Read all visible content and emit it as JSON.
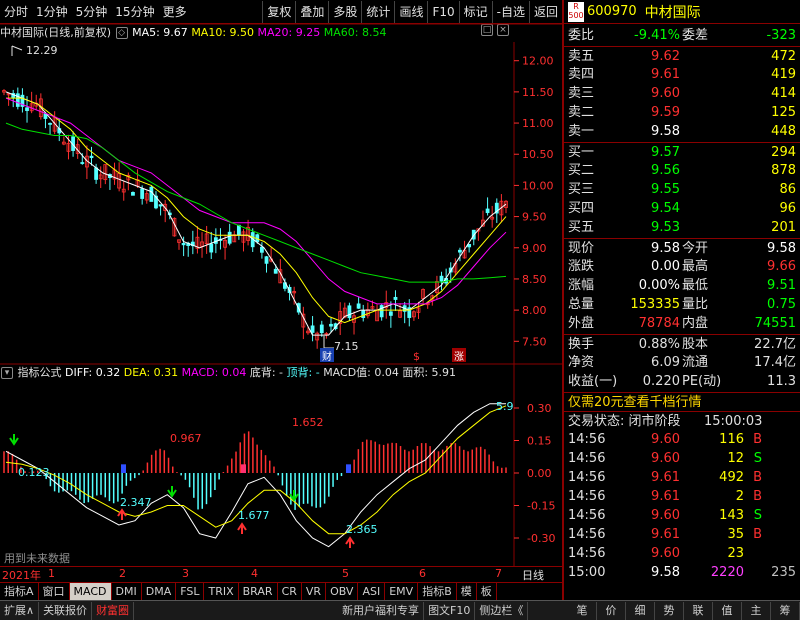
{
  "toolbar": {
    "left": [
      "分时",
      "1分钟",
      "5分钟",
      "15分钟",
      "更多"
    ],
    "right": [
      "复权",
      "叠加",
      "多股",
      "统计",
      "画线",
      "F10",
      "标记",
      "-自选",
      "返回"
    ]
  },
  "main_head": {
    "name": "中材国际(日线,前复权)",
    "ma5": "MA5: 9.67",
    "ma10": "MA10: 9.50",
    "ma20": "MA20: 9.25",
    "ma60": "MA60: 8.54"
  },
  "ind_head": {
    "name": "指标公式",
    "diff": "DIFF: 0.32",
    "dea": "DEA: 0.31",
    "macd": "MACD: 0.04",
    "dibei": "底背: -",
    "dingbei": "顶背: -",
    "macdval": "MACD值: 0.04",
    "area": "面积: 5.91"
  },
  "colors": {
    "ma5": "#ffffff",
    "ma10": "#ffff00",
    "ma20": "#ff00ff",
    "ma60": "#00e000",
    "up": "#ff3030",
    "down": "#54ffff"
  },
  "chart_data": [
    {
      "type": "candlestick",
      "title": "中材国际(日线,前复权)",
      "ylim": [
        7.2,
        12.3
      ],
      "y_ticks": [
        "12.00",
        "11.50",
        "11.00",
        "10.50",
        "10.00",
        "9.50",
        "9.00",
        "8.50",
        "8.00",
        "7.50"
      ],
      "annotations": [
        "12.29",
        "7.15",
        "财",
        "$",
        "涨"
      ],
      "series": [
        {
          "name": "MA5",
          "values": [
            11.5,
            11.4,
            11.3,
            11.0,
            10.7,
            10.4,
            10.2,
            10.1,
            10.0,
            9.9,
            9.6,
            9.1,
            9.0,
            9.1,
            9.2,
            9.2,
            9.0,
            8.6,
            8.1,
            7.6,
            7.6,
            7.9,
            8.0,
            8.0,
            8.1,
            8.0,
            8.2,
            8.4,
            8.8,
            9.2,
            9.5,
            9.7
          ]
        },
        {
          "name": "MA10",
          "values": [
            11.4,
            11.4,
            11.3,
            11.1,
            10.9,
            10.6,
            10.4,
            10.2,
            10.1,
            10.0,
            9.8,
            9.5,
            9.3,
            9.2,
            9.2,
            9.2,
            9.1,
            8.9,
            8.6,
            8.2,
            7.9,
            7.8,
            7.9,
            8.0,
            8.0,
            8.0,
            8.1,
            8.3,
            8.6,
            8.9,
            9.2,
            9.5
          ]
        },
        {
          "name": "MA20",
          "values": [
            11.4,
            11.3,
            11.2,
            11.1,
            11.0,
            10.8,
            10.6,
            10.4,
            10.3,
            10.2,
            10.0,
            9.8,
            9.6,
            9.5,
            9.4,
            9.4,
            9.4,
            9.3,
            9.1,
            8.8,
            8.5,
            8.3,
            8.2,
            8.1,
            8.1,
            8.1,
            8.1,
            8.2,
            8.4,
            8.7,
            9.0,
            9.25
          ]
        },
        {
          "name": "MA60",
          "values": [
            11.0,
            10.9,
            10.85,
            10.8,
            10.8,
            10.75,
            10.6,
            10.4,
            10.2,
            10.05,
            9.9,
            9.8,
            9.7,
            9.55,
            9.4,
            9.3,
            9.2,
            9.1,
            9.0,
            8.9,
            8.8,
            8.7,
            8.6,
            8.55,
            8.5,
            8.45,
            8.45,
            8.45,
            8.5,
            8.5,
            8.52,
            8.54
          ]
        }
      ]
    },
    {
      "type": "bar",
      "title": "指标公式",
      "ylim": [
        -0.42,
        0.42
      ],
      "y_ticks": [
        "0.30",
        "0.15",
        "0.00",
        "-0.15",
        "-0.30"
      ],
      "annotations": [
        "0.123",
        "0.967",
        "1.652",
        "2.347",
        "1.677",
        "2.365",
        "5.9",
        "用到未来数据"
      ],
      "series": [
        {
          "name": "DIFF",
          "values": [
            0.1,
            0.06,
            0.02,
            -0.04,
            -0.1,
            -0.16,
            -0.2,
            -0.24,
            -0.22,
            -0.14,
            -0.1,
            -0.16,
            -0.28,
            -0.3,
            -0.18,
            -0.05,
            -0.02,
            -0.1,
            -0.22,
            -0.3,
            -0.34,
            -0.28,
            -0.18,
            -0.1,
            -0.04,
            0.02,
            0.06,
            0.14,
            0.22,
            0.28,
            0.32,
            0.32
          ]
        },
        {
          "name": "DEA",
          "values": [
            0.05,
            0.04,
            0.02,
            -0.01,
            -0.05,
            -0.1,
            -0.14,
            -0.18,
            -0.2,
            -0.18,
            -0.15,
            -0.15,
            -0.2,
            -0.25,
            -0.22,
            -0.14,
            -0.08,
            -0.08,
            -0.14,
            -0.22,
            -0.28,
            -0.28,
            -0.24,
            -0.18,
            -0.1,
            -0.04,
            0.0,
            0.08,
            0.16,
            0.22,
            0.28,
            0.31
          ]
        }
      ]
    }
  ],
  "x_axis": [
    "2021年",
    "1",
    "2",
    "3",
    "4",
    "5",
    "6",
    "7",
    "日线"
  ],
  "tabs": [
    "指标A",
    "窗口",
    "MACD",
    "DMI",
    "DMA",
    "FSL",
    "TRIX",
    "BRAR",
    "CR",
    "VR",
    "OBV",
    "ASI",
    "EMV",
    "指标B",
    "模",
    "板"
  ],
  "panel": {
    "badge": "R 500",
    "code": "600970",
    "name": "中材国际",
    "weibi_label": "委比",
    "weibi": "-9.41%",
    "weicha_label": "委差",
    "weicha": "-323",
    "asks": [
      {
        "label": "卖五",
        "price": "9.62",
        "vol": "472"
      },
      {
        "label": "卖四",
        "price": "9.61",
        "vol": "419"
      },
      {
        "label": "卖三",
        "price": "9.60",
        "vol": "414"
      },
      {
        "label": "卖二",
        "price": "9.59",
        "vol": "125"
      },
      {
        "label": "卖一",
        "price": "9.58",
        "vol": "448"
      }
    ],
    "bids": [
      {
        "label": "买一",
        "price": "9.57",
        "vol": "294"
      },
      {
        "label": "买二",
        "price": "9.56",
        "vol": "878"
      },
      {
        "label": "买三",
        "price": "9.55",
        "vol": "86"
      },
      {
        "label": "买四",
        "price": "9.54",
        "vol": "96"
      },
      {
        "label": "买五",
        "price": "9.53",
        "vol": "201"
      }
    ],
    "quote": [
      {
        "l1": "现价",
        "v1": "9.58",
        "c1": "#ffffff",
        "l2": "今开",
        "v2": "9.58",
        "c2": "#ffffff"
      },
      {
        "l1": "涨跌",
        "v1": "0.00",
        "c1": "#ffffff",
        "l2": "最高",
        "v2": "9.66",
        "c2": "#ff3030"
      },
      {
        "l1": "涨幅",
        "v1": "0.00%",
        "c1": "#ffffff",
        "l2": "最低",
        "v2": "9.51",
        "c2": "#00ff00"
      },
      {
        "l1": "总量",
        "v1": "153335",
        "c1": "#ffff00",
        "l2": "量比",
        "v2": "0.75",
        "c2": "#00ff00"
      },
      {
        "l1": "外盘",
        "v1": "78784",
        "c1": "#ff3030",
        "l2": "内盘",
        "v2": "74551",
        "c2": "#00ff00"
      }
    ],
    "fund": [
      {
        "l1": "换手",
        "v1": "0.88%",
        "l2": "股本",
        "v2": "22.7亿"
      },
      {
        "l1": "净资",
        "v1": "6.09",
        "l2": "流通",
        "v2": "17.4亿"
      },
      {
        "l1": "收益(一)",
        "v1": "0.220",
        "l2": "PE(动)",
        "v2": "11.3"
      }
    ],
    "promo": "仅需20元查看千档行情",
    "status_label": "交易状态: 闭市阶段",
    "status_time": "15:00:03",
    "trades": [
      {
        "t": "14:56",
        "p": "9.60",
        "pc": "#ff3030",
        "v": "116",
        "vc": "#ffff00",
        "d": "B",
        "dc": "#ff3030"
      },
      {
        "t": "14:56",
        "p": "9.60",
        "pc": "#ff3030",
        "v": "12",
        "vc": "#ffff00",
        "d": "S",
        "dc": "#00ff00"
      },
      {
        "t": "14:56",
        "p": "9.61",
        "pc": "#ff3030",
        "v": "492",
        "vc": "#ffff00",
        "d": "B",
        "dc": "#ff3030"
      },
      {
        "t": "14:56",
        "p": "9.61",
        "pc": "#ff3030",
        "v": "2",
        "vc": "#ffff00",
        "d": "B",
        "dc": "#ff3030"
      },
      {
        "t": "14:56",
        "p": "9.60",
        "pc": "#ff3030",
        "v": "143",
        "vc": "#ffff00",
        "d": "S",
        "dc": "#00ff00"
      },
      {
        "t": "14:56",
        "p": "9.61",
        "pc": "#ff3030",
        "v": "35",
        "vc": "#ffff00",
        "d": "B",
        "dc": "#ff3030"
      },
      {
        "t": "14:56",
        "p": "9.60",
        "pc": "#ff3030",
        "v": "23",
        "vc": "#ffff00",
        "d": "",
        "dc": "#ff3030"
      },
      {
        "t": "15:00",
        "p": "9.58",
        "pc": "#ffffff",
        "v": "2220",
        "vc": "#ff40ff",
        "d": "235",
        "dc": "#c0c0c0"
      }
    ]
  },
  "footer": {
    "left": [
      "扩展∧",
      "关联报价",
      "财富圈"
    ],
    "mid": [
      "新用户福利专享",
      "图文F10",
      "侧边栏《"
    ],
    "right": [
      "笔",
      "价",
      "细",
      "势",
      "联",
      "值",
      "主",
      "筹"
    ]
  }
}
